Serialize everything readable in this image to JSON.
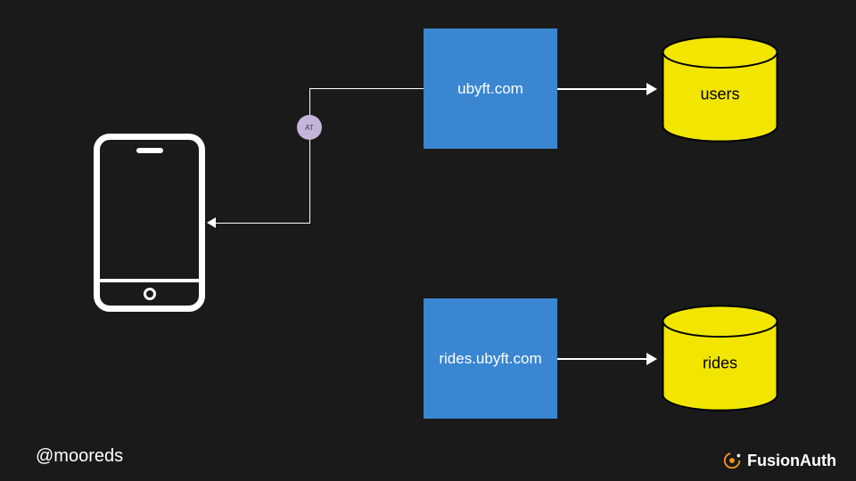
{
  "diagram": {
    "phone": {
      "name": "mobile-client"
    },
    "servers": [
      {
        "label": "ubyft.com"
      },
      {
        "label": "rides.ubyft.com"
      }
    ],
    "databases": [
      {
        "label": "users"
      },
      {
        "label": "rides"
      }
    ],
    "token_badge": "AT"
  },
  "footer": {
    "handle": "@mooreds",
    "brand": "FusionAuth"
  },
  "colors": {
    "bg": "#1a1a1a",
    "server": "#3a86d1",
    "db_fill": "#f2e600",
    "db_stroke": "#000000",
    "token": "#c5b4d9",
    "accent": "#f7931e"
  }
}
